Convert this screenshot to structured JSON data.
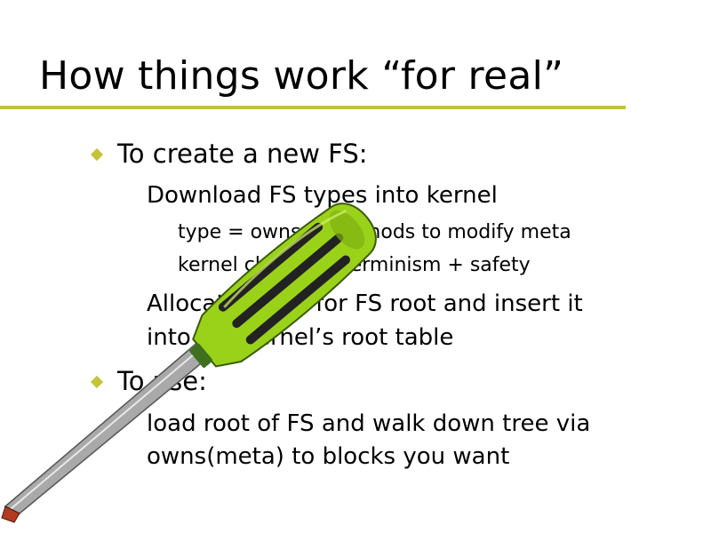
{
  "slide": {
    "title": "How things work “for real”",
    "accent_color": "#c4c43a",
    "bullets": [
      {
        "text": "To create a new FS:",
        "sub": [
          {
            "lines": [
              "Download FS types into kernel"
            ],
            "sub": [
              "type = owns + methods to modify meta",
              "kernel checks determinism + safety"
            ]
          },
          {
            "lines": [
              "Allocate block for FS root and insert it",
              "into the kernel’s root table"
            ],
            "sub": []
          }
        ]
      },
      {
        "text": "To use:",
        "sub": [
          {
            "lines": [
              "load root of FS and walk down tree via",
              "owns(meta) to blocks you want"
            ],
            "sub": []
          }
        ]
      }
    ]
  },
  "clipart": {
    "icon": "screwdriver-icon",
    "handle_color": "#9ad21a",
    "grip_color": "#222222"
  }
}
